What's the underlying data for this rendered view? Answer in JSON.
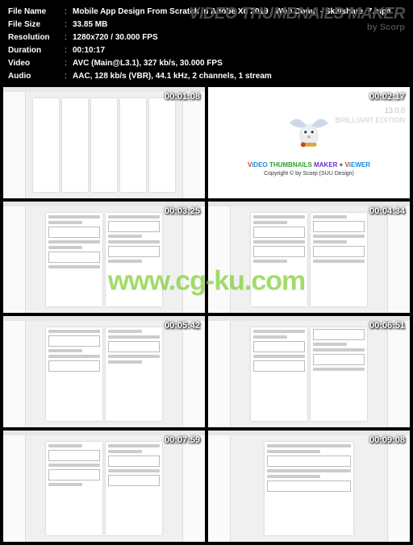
{
  "header": {
    "rows": [
      {
        "label": "File Name",
        "value": "Mobile App Design From Scratch In Adobe Xd 2019 - Web Donut - Skillshare_7.mp4"
      },
      {
        "label": "File Size",
        "value": "33.85 MB"
      },
      {
        "label": "Resolution",
        "value": "1280x720 / 30.000 FPS"
      },
      {
        "label": "Duration",
        "value": "00:10:17"
      },
      {
        "label": "Video",
        "value": "AVC (Main@L3.1), 327 kb/s, 30.000 FPS"
      },
      {
        "label": "Audio",
        "value": "AAC, 128 kb/s (VBR), 44.1 kHz, 2 channels, 1 stream"
      }
    ],
    "watermark_title": "VIDEO THUMBNAILS MAKER",
    "watermark_sub": "by Scorp"
  },
  "thumbs": [
    {
      "ts": "00:01:08"
    },
    {
      "ts": "00:02:17",
      "version": "13.0.0",
      "edition": "BRILLIANT\nEDITION",
      "title_parts": [
        {
          "t": "V",
          "c": "#e53a1e"
        },
        {
          "t": "i",
          "c": "#1c8be0"
        },
        {
          "t": "DEO ",
          "c": "#1c8be0"
        },
        {
          "t": "THUMBNAILS ",
          "c": "#2aa02a"
        },
        {
          "t": "MAKER ",
          "c": "#6a31c9"
        },
        {
          "t": "+ ",
          "c": "#333"
        },
        {
          "t": "V",
          "c": "#e53a1e"
        },
        {
          "t": "i",
          "c": "#1c8be0"
        },
        {
          "t": "EWER",
          "c": "#1c8be0"
        }
      ],
      "copyright": "Copyright © by Scorp (SUU Design)"
    },
    {
      "ts": "00:03:25"
    },
    {
      "ts": "00:04:34"
    },
    {
      "ts": "00:05:42"
    },
    {
      "ts": "00:06:51"
    },
    {
      "ts": "00:07:59"
    },
    {
      "ts": "00:09:08"
    }
  ],
  "page_watermark": "www.cg-ku.com"
}
